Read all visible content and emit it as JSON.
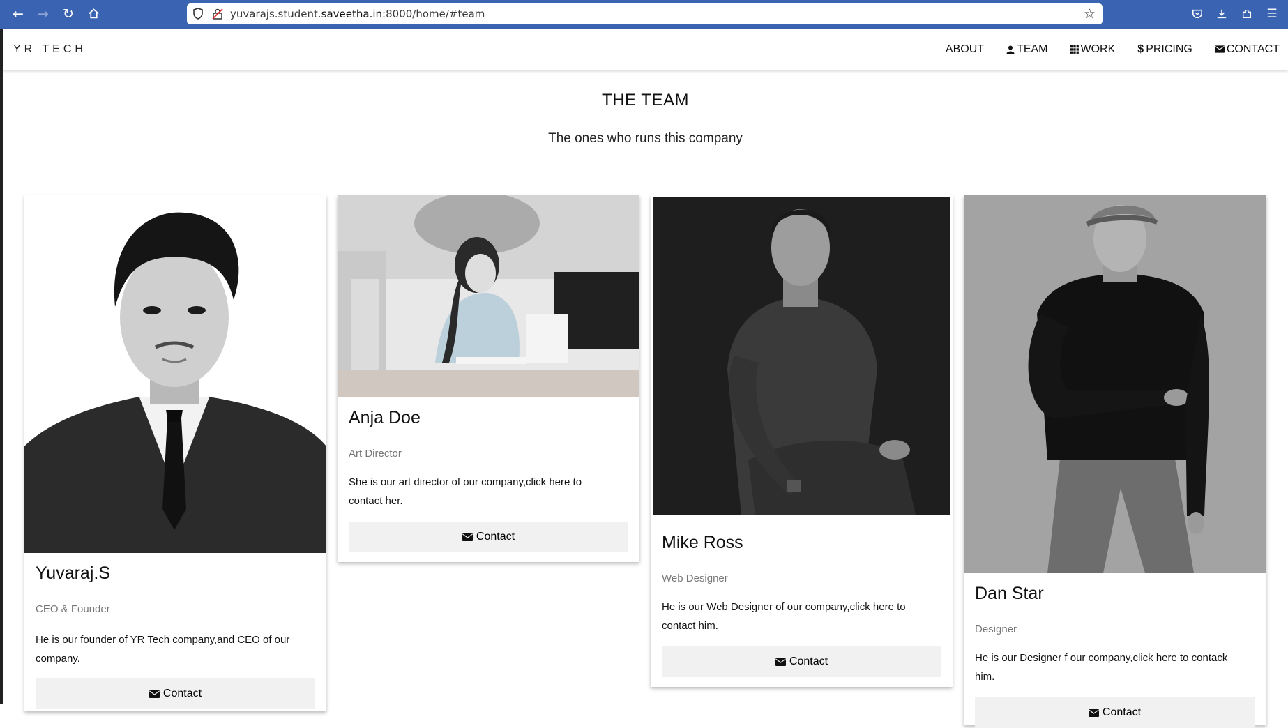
{
  "browser": {
    "url_prefix": "yuvarajs.student.",
    "url_domain": "saveetha.in",
    "url_suffix": ":8000/home/#team"
  },
  "site": {
    "brand": "YR TECH",
    "nav": [
      {
        "label": "ABOUT",
        "icon": "none"
      },
      {
        "label": "TEAM",
        "icon": "user-icon"
      },
      {
        "label": "WORK",
        "icon": "grid-icon"
      },
      {
        "label": "PRICING",
        "icon": "dollar-icon"
      },
      {
        "label": "CONTACT",
        "icon": "envelope-icon"
      }
    ]
  },
  "team": {
    "title": "THE TEAM",
    "subtitle": "The ones who runs this company",
    "members": [
      {
        "name": "Yuvaraj.S",
        "role": "CEO & Founder",
        "description": "He is our founder of YR Tech company,and CEO of our company.",
        "button": "Contact"
      },
      {
        "name": "Anja Doe",
        "role": "Art Director",
        "description": "She is our art director of our company,click here to contact her.",
        "button": "Contact"
      },
      {
        "name": "Mike Ross",
        "role": "Web Designer",
        "description": "He is our Web Designer of our company,click here to contact him.",
        "button": "Contact"
      },
      {
        "name": "Dan Star",
        "role": "Designer",
        "description": "He is our Designer f our company,click here to contack him.",
        "button": "Contact"
      }
    ]
  },
  "colors": {
    "browser_toolbar": "#3a63b1",
    "button_bg": "#f1f1f1",
    "role_text": "#777777"
  }
}
